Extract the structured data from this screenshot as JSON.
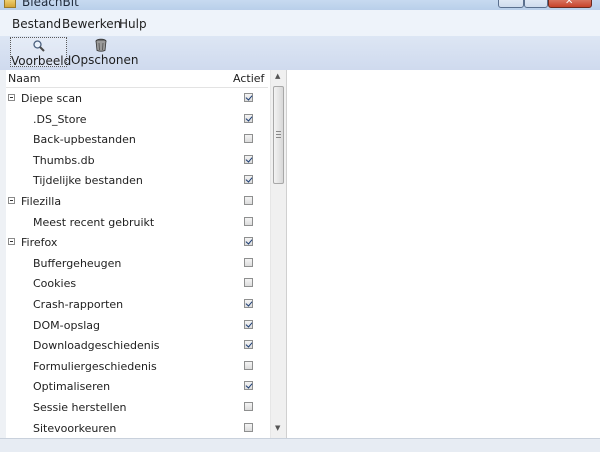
{
  "window": {
    "title": "BleachBit",
    "close_symbol": "✕"
  },
  "menubar": {
    "items": [
      {
        "label": "Bestand"
      },
      {
        "label": "Bewerken"
      },
      {
        "label": "Hulp"
      }
    ]
  },
  "toolbar": {
    "preview_label": "Voorbeeld",
    "preview_icon": "magnifier-icon",
    "clean_label": "Opschonen",
    "clean_icon": "trash-can-icon"
  },
  "tree": {
    "headers": {
      "name": "Naam",
      "active": "Actief"
    },
    "rows": [
      {
        "label": "Diepe scan",
        "level": 0,
        "checked": true
      },
      {
        "label": ".DS_Store",
        "level": 1,
        "checked": true
      },
      {
        "label": "Back-upbestanden",
        "level": 1,
        "checked": false
      },
      {
        "label": "Thumbs.db",
        "level": 1,
        "checked": true
      },
      {
        "label": "Tijdelijke bestanden",
        "level": 1,
        "checked": true
      },
      {
        "label": "Filezilla",
        "level": 0,
        "checked": false
      },
      {
        "label": "Meest recent gebruikt",
        "level": 1,
        "checked": false
      },
      {
        "label": "Firefox",
        "level": 0,
        "checked": true
      },
      {
        "label": "Buffergeheugen",
        "level": 1,
        "checked": false
      },
      {
        "label": "Cookies",
        "level": 1,
        "checked": false
      },
      {
        "label": "Crash-rapporten",
        "level": 1,
        "checked": true
      },
      {
        "label": "DOM-opslag",
        "level": 1,
        "checked": true
      },
      {
        "label": "Downloadgeschiedenis",
        "level": 1,
        "checked": true
      },
      {
        "label": "Formuliergeschiedenis",
        "level": 1,
        "checked": false
      },
      {
        "label": "Optimaliseren",
        "level": 1,
        "checked": true
      },
      {
        "label": "Sessie herstellen",
        "level": 1,
        "checked": false
      },
      {
        "label": "Sitevoorkeuren",
        "level": 1,
        "checked": false
      }
    ]
  },
  "colors": {
    "toolbar_bg": "#cfdaee",
    "menubar_bg": "#eef3fa",
    "check_color": "#1b3c74"
  }
}
